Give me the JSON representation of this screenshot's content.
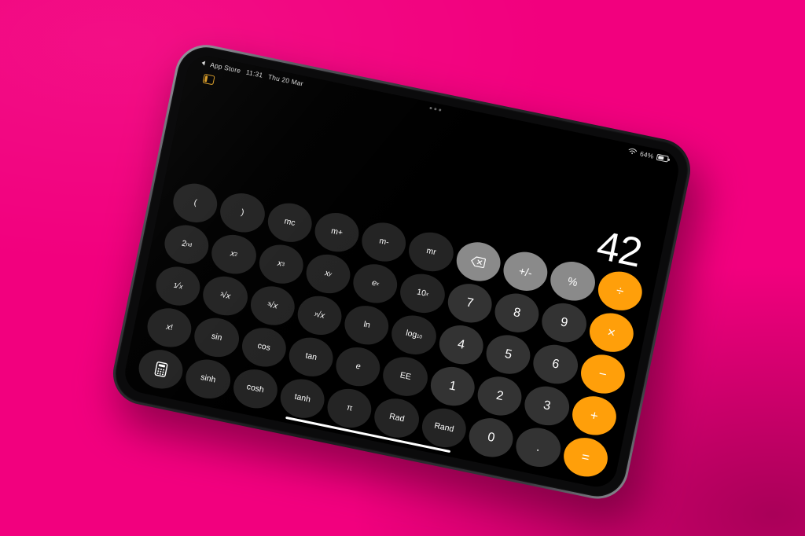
{
  "background": {
    "color": "#f2007e"
  },
  "device": {
    "name": "ipad",
    "orientation": "landscape"
  },
  "status_bar": {
    "back_app_label": "App Store",
    "time": "11:31",
    "date": "Thu 20 Mar",
    "battery_percent": "64%",
    "wifi_icon": "wifi-icon",
    "battery_icon": "battery-icon",
    "back_icon": "back-triangle-icon",
    "splitview_icon": "splitview-indicator-icon",
    "multitask_icon": "multitask-handle-icon"
  },
  "calculator": {
    "display_value": "42",
    "keys": {
      "open_paren": "(",
      "close_paren": ")",
      "mc": "mc",
      "m_plus": "m+",
      "m_minus": "m-",
      "mr": "mr",
      "second": "2nd",
      "x_squared": "x2",
      "x_cubed": "x3",
      "x_pow_y": "xy",
      "e_pow_x": "ex",
      "ten_pow_x": "10x",
      "one_over_x": "1/x",
      "sqrt2": "2√x",
      "sqrt3": "3√x",
      "sqrty": "y√x",
      "ln": "ln",
      "log10": "log10",
      "factorial": "x!",
      "sin": "sin",
      "cos": "cos",
      "tan": "tan",
      "e": "e",
      "ee": "EE",
      "calc_toggle": "calculator-icon",
      "sinh": "sinh",
      "cosh": "cosh",
      "tanh": "tanh",
      "pi": "π",
      "rad": "Rad",
      "rand": "Rand",
      "backspace": "backspace-icon",
      "sign": "+/-",
      "percent": "%",
      "divide": "÷",
      "multiply": "×",
      "minus": "−",
      "plus": "+",
      "equals": "=",
      "decimal": ".",
      "d0": "0",
      "d1": "1",
      "d2": "2",
      "d3": "3",
      "d4": "4",
      "d5": "5",
      "d6": "6",
      "d7": "7",
      "d8": "8",
      "d9": "9"
    },
    "colors": {
      "operator": "#ff9f0a",
      "utility": "#8a8a8a",
      "digit": "#333333",
      "scientific": "#242424",
      "display_text": "#ffffff"
    }
  }
}
